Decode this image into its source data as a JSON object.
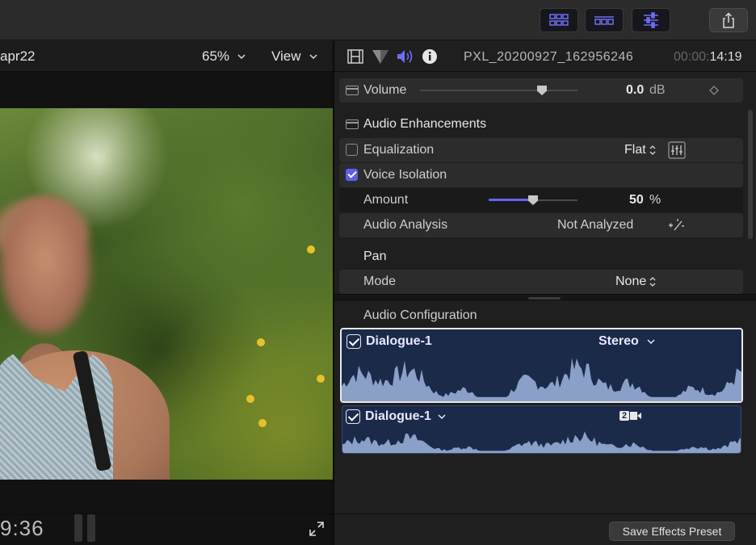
{
  "toolbar": {
    "buttons": [
      "browser-layout-icon",
      "timeline-layout-icon",
      "inspector-sliders-icon",
      "share-icon"
    ]
  },
  "viewer": {
    "title": "apr22",
    "zoom": "65%",
    "view_label": "View",
    "timecode": "9:36"
  },
  "inspector": {
    "clip_name": "PXL_20200927_162956246",
    "clip_tc_dim": "00:00:",
    "clip_tc": "14:19",
    "volume": {
      "label": "Volume",
      "value": "0.0",
      "unit": "dB"
    },
    "enhancements": {
      "label": "Audio Enhancements"
    },
    "equalization": {
      "label": "Equalization",
      "value": "Flat",
      "checked": false
    },
    "voice_isolation": {
      "label": "Voice Isolation",
      "checked": true
    },
    "amount": {
      "label": "Amount",
      "value": "50",
      "unit": "%",
      "level": 0.5
    },
    "analysis": {
      "label": "Audio Analysis",
      "value": "Not Analyzed"
    },
    "pan": {
      "label": "Pan"
    },
    "mode": {
      "label": "Mode",
      "value": "None"
    }
  },
  "audio_config": {
    "label": "Audio Configuration",
    "tracks": [
      {
        "name": "Dialogue-1",
        "format": "Stereo",
        "checked": true
      },
      {
        "name": "Dialogue-1",
        "badge": "2",
        "checked": true
      }
    ]
  },
  "footer": {
    "save_preset": "Save Effects Preset"
  },
  "colors": {
    "accent": "#6464f0",
    "wave": "#8aa0c8",
    "card": "#1c2a4a"
  }
}
